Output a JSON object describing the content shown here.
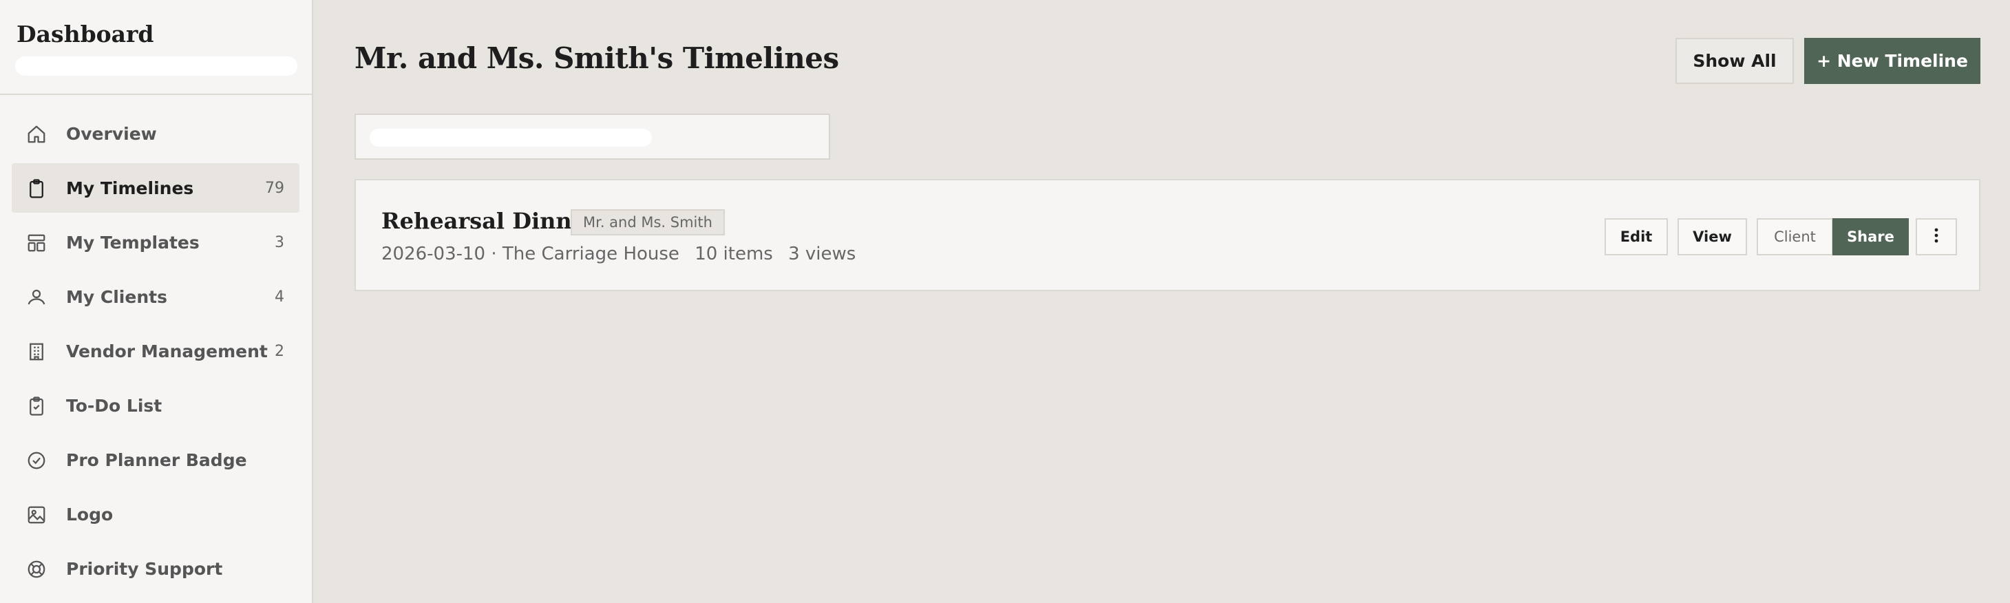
{
  "sidebar": {
    "title": "Dashboard",
    "items": [
      {
        "label": "Overview",
        "count": "",
        "icon": "home-icon"
      },
      {
        "label": "My Timelines",
        "count": "79",
        "icon": "clipboard-icon",
        "active": true
      },
      {
        "label": "My Templates",
        "count": "3",
        "icon": "template-icon"
      },
      {
        "label": "My Clients",
        "count": "4",
        "icon": "users-icon"
      },
      {
        "label": "Vendor Management",
        "count": "2",
        "icon": "building-icon"
      },
      {
        "label": "To-Do List",
        "count": "",
        "icon": "clipboard-check-icon"
      },
      {
        "label": "Pro Planner Badge",
        "count": "",
        "icon": "badge-check-icon"
      },
      {
        "label": "Logo",
        "count": "",
        "icon": "image-icon"
      },
      {
        "label": "Priority Support",
        "count": "",
        "icon": "lifebuoy-icon"
      }
    ]
  },
  "header": {
    "title": "Mr. and Ms. Smith's Timelines",
    "show_all_label": "Show All",
    "new_timeline_label": "+ New Timeline"
  },
  "search": {
    "placeholder": ""
  },
  "timelines": [
    {
      "title": "Rehearsal Dinner",
      "client": "Mr. and Ms. Smith",
      "date_venue": "2026-03-10 · The Carriage House",
      "items": "10 items",
      "views": "3 views",
      "actions": {
        "edit": "Edit",
        "view": "View",
        "client": "Client",
        "share": "Share"
      }
    }
  ],
  "colors": {
    "accent": "#506555",
    "background": "#e8e5e0",
    "sidebar": "#f6f5f3"
  }
}
